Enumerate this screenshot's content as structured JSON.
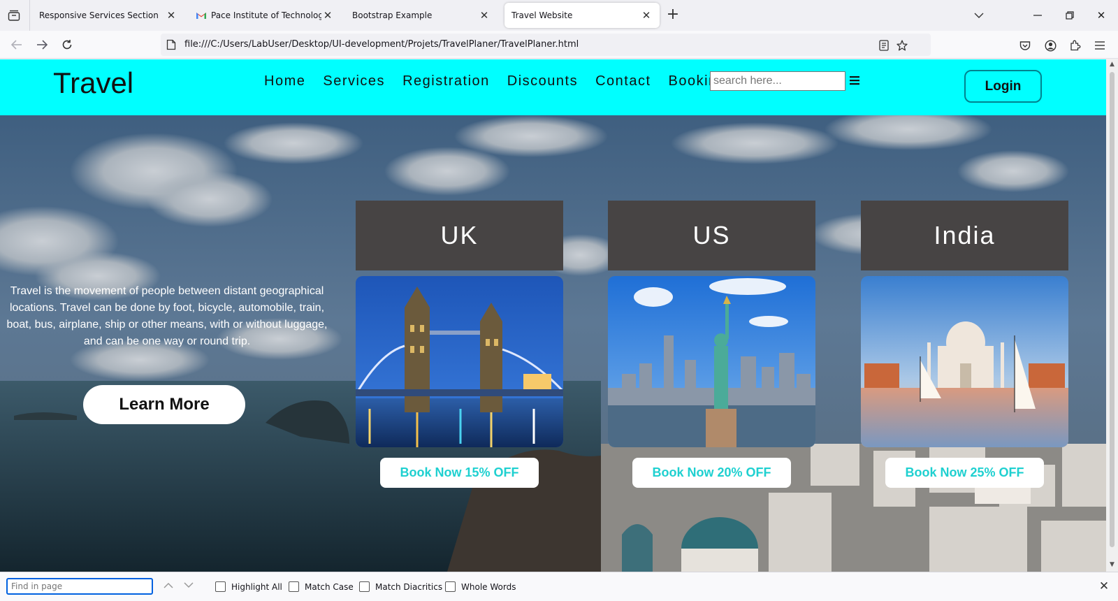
{
  "browser": {
    "tabs": [
      {
        "title": "Responsive Services Section",
        "active": false
      },
      {
        "title": "Pace Institute of Technology An",
        "active": false
      },
      {
        "title": "Bootstrap Example",
        "active": false
      },
      {
        "title": "Travel Website",
        "active": true
      }
    ],
    "url": "file:///C:/Users/LabUser/Desktop/UI-development/Projets/TravelPlaner/TravelPlaner.html"
  },
  "site": {
    "logo": "Travel",
    "menu": [
      "Home",
      "Services",
      "Registration",
      "Discounts",
      "Contact",
      "Booking"
    ],
    "search_placeholder": "search here...",
    "login_label": "Login"
  },
  "hero": {
    "description": "Travel is the movement of people between distant geographical locations. Travel can be done by foot, bicycle, automobile, train, boat, bus, airplane, ship or other means, with or without luggage, and can be one way or round trip.",
    "cta_label": "Learn More",
    "cards": [
      {
        "country": "UK",
        "button": "Book Now 15% OFF",
        "discount_percent": 15
      },
      {
        "country": "US",
        "button": "Book Now 20% OFF",
        "discount_percent": 20
      },
      {
        "country": "India",
        "button": "Book Now 25% OFF",
        "discount_percent": 25
      }
    ]
  },
  "findbar": {
    "placeholder": "Find in page",
    "options": [
      "Highlight All",
      "Match Case",
      "Match Diacritics",
      "Whole Words"
    ]
  },
  "colors": {
    "header_bg": "#00ffff",
    "card_title_bg": "#474444",
    "book_button_text": "#1fd0d0"
  }
}
